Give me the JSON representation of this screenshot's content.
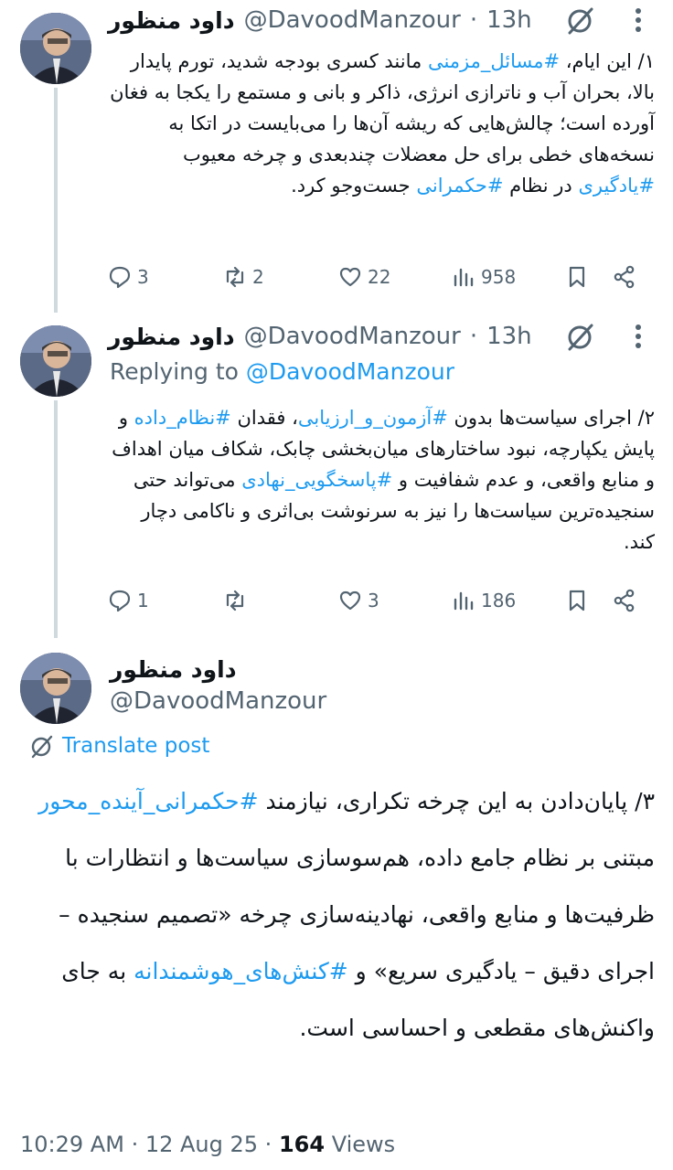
{
  "tweets": [
    {
      "author_name": "داود منظور",
      "author_handle": "@DavoodManzour",
      "time": "13h",
      "segments": [
        {
          "t": "۱/ این ایام، "
        },
        {
          "t": "#مسائل_مزمنی",
          "tag": true
        },
        {
          "t": " مانند کسری بودجه شدید، تورم پایدار بالا، بحران آب و ناترازی انرژی، ذاکر و بانی و مستمع را یکجا به فغان آورده است؛ چالش‌هایی که ریشه آن‌ها را می‌بایست در اتکا به نسخه‌های خطی برای حل معضلات چندبعدی و چرخه معیوب "
        },
        {
          "t": "#یادگیری",
          "tag": true
        },
        {
          "t": " در نظام "
        },
        {
          "t": "#حکمرانی",
          "tag": true
        },
        {
          "t": " جست‌وجو کرد."
        }
      ],
      "stats": {
        "replies": "3",
        "reposts": "2",
        "likes": "22",
        "views": "958"
      }
    },
    {
      "author_name": "داود منظور",
      "author_handle": "@DavoodManzour",
      "time": "13h",
      "replying_prefix": "Replying to",
      "replying_to": "@DavoodManzour",
      "segments": [
        {
          "t": "۲/ اجرای سیاست‌ها بدون "
        },
        {
          "t": "#آزمون_و_ارزیابی",
          "tag": true
        },
        {
          "t": "، فقدان "
        },
        {
          "t": "#نظام_داده",
          "tag": true
        },
        {
          "t": " و پایش یکپارچه، نبود ساختارهای میان‌بخشی چابک، شکاف میان اهداف و منابع واقعی، و عدم شفافیت و "
        },
        {
          "t": "#پاسخگویی_نهادی",
          "tag": true
        },
        {
          "t": " می‌تواند حتی سنجیده‌ترین سیاست‌ها را نیز به سرنوشت بی‌اثری و ناکامی دچار کند."
        }
      ],
      "stats": {
        "replies": "1",
        "reposts": "",
        "likes": "3",
        "views": "186"
      }
    }
  ],
  "main_post": {
    "author_name": "داود منظور",
    "author_handle": "@DavoodManzour",
    "translate_label": "Translate post",
    "segments": [
      {
        "t": "۳/ پایان‌دادن به این چرخه تکراری، نیازمند "
      },
      {
        "t": "#حکمرانی_آینده_محور",
        "tag": true
      },
      {
        "t": " مبتنی بر نظام جامع داده، هم‌سوسازی سیاست‌ها و انتظارات با ظرفیت‌ها و منابع واقعی، نهادینه‌سازی چرخه «تصمیم سنجیده – اجرای دقیق – یادگیری سریع» و "
      },
      {
        "t": "#کنش‌های_هوشمندانه",
        "tag": true
      },
      {
        "t": " به جای واکنش‌های مقطعی و احساسی است."
      }
    ],
    "time": "10:29 AM",
    "date": "12 Aug 25",
    "views": "164",
    "views_label": "Views"
  },
  "colors": {
    "accent": "#1d9bf0",
    "muted": "#536471",
    "text": "#0f1419",
    "thread_line": "#cfd9de"
  },
  "icons": [
    "reply-icon",
    "repost-icon",
    "like-icon",
    "views-icon",
    "bookmark-icon",
    "share-icon",
    "grok-icon",
    "more-icon",
    "translate-icon"
  ]
}
